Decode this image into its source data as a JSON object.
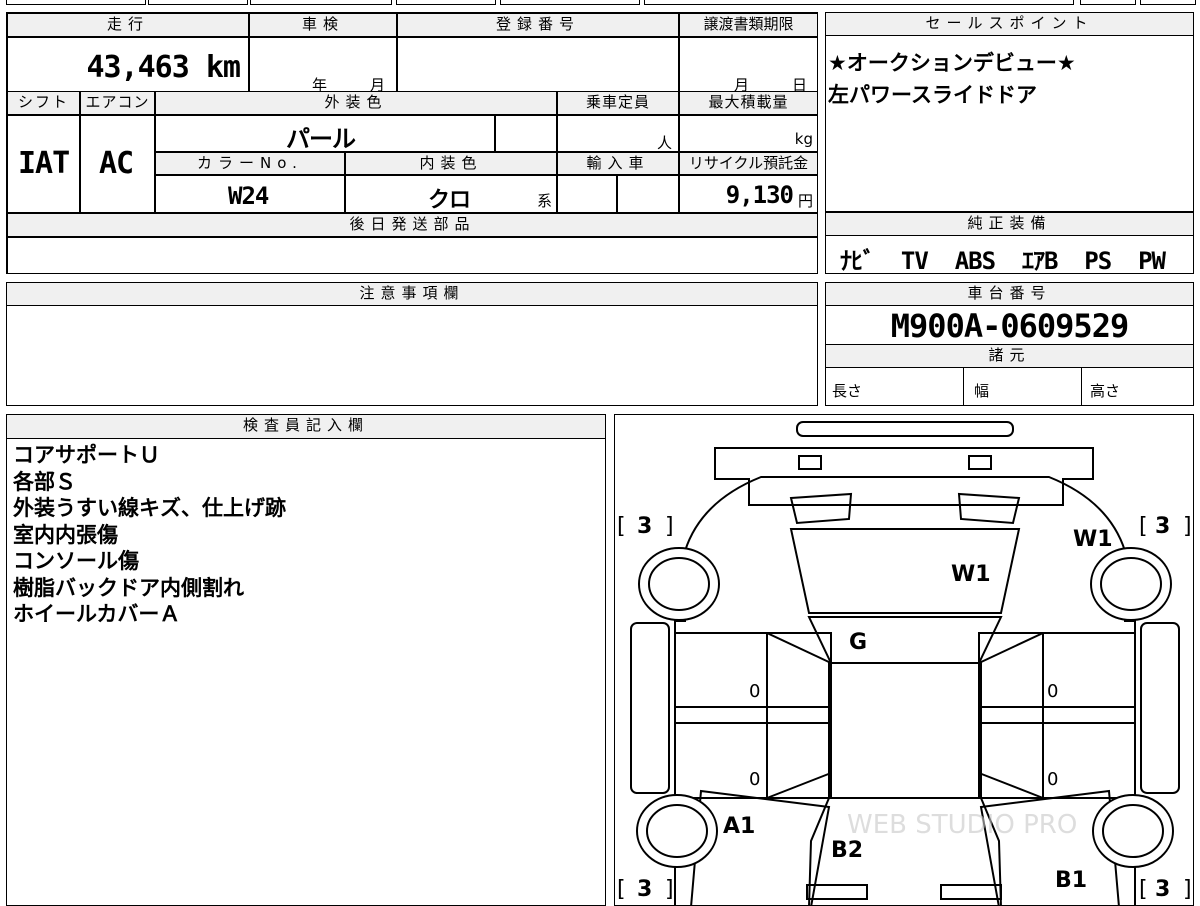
{
  "sheet": {
    "mileage_header": "走行",
    "mileage": "43,463 km",
    "shaken_header": "車検",
    "shaken_year_unit": "年",
    "shaken_month_unit": "月",
    "registration_header": "登録番号",
    "transfer_header": "譲渡書類期限",
    "transfer_month_unit": "月",
    "transfer_day_unit": "日",
    "shift_header": "シフト",
    "shift": "IAT",
    "ac_header": "エアコン",
    "ac": "AC",
    "exterior_color_header": "外装色",
    "exterior_color": "パール",
    "capacity_header": "乗車定員",
    "capacity_unit": "人",
    "max_load_header": "最大積載量",
    "max_load_unit": "kg",
    "color_no_header": "カラーNo.",
    "color_no": "W24",
    "interior_color_header": "内装色",
    "interior_color": "クロ",
    "interior_suffix": "系",
    "import_header": "輸入車",
    "recycle_header": "リサイクル預託金",
    "recycle_fee": "9,130",
    "recycle_unit": "円",
    "later_parts_header": "後日発送部品",
    "sales_header": "セールスポイント",
    "sales_points": [
      "★オークションデビュー★",
      "左パワースライドドア"
    ],
    "equipment_header": "純正装備",
    "equipment": "ﾅﾋﾞ  TV  ABS  ｴｱB  PS  PW",
    "notes_header": "注意事項欄",
    "chassis_header": "車台番号",
    "chassis_no": "M900A-0609529",
    "specs_header": "諸元",
    "spec_length": "長さ",
    "spec_width": "幅",
    "spec_height": "高さ",
    "inspector_header": "検査員記入欄",
    "inspector_notes": [
      "コアサポートＵ",
      "各部Ｓ",
      "外装うすい線キズ、仕上げ跡",
      "室内内張傷",
      "コンソール傷",
      "樹脂バックドア内側割れ",
      "ホイールカバーＡ"
    ]
  },
  "diagram": {
    "tire_fl": "3",
    "tire_fr": "3",
    "tire_rl": "3",
    "tire_rr": "3",
    "windshield": "W1",
    "right_front_mark": "W1",
    "roof_mark": "G",
    "door_left_front": "0",
    "door_left_rear": "0",
    "door_right_front": "0",
    "door_right_rear": "0",
    "rear_left_mark": "A1",
    "rear_center_mark": "B2",
    "rear_right_mark": "B1",
    "watermark": "WEB STUDIO PRO"
  }
}
